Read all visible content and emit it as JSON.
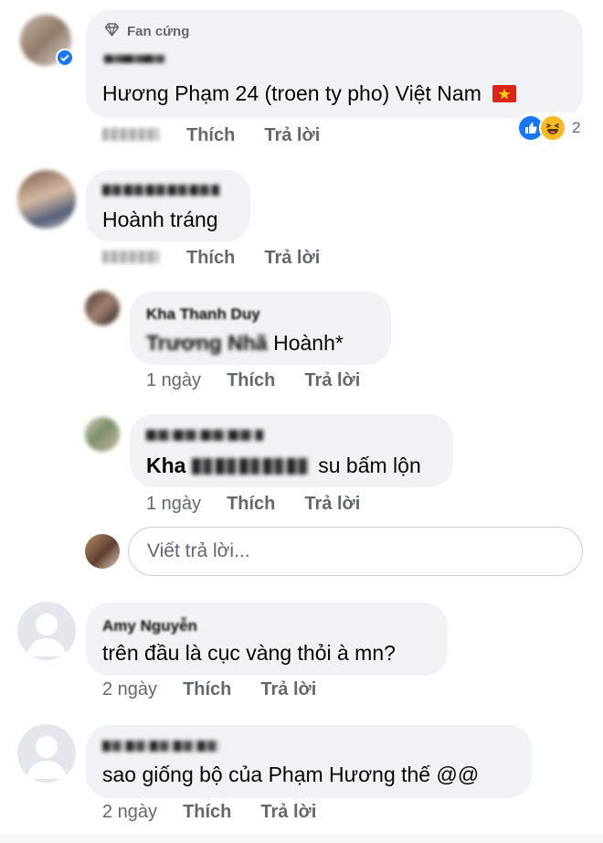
{
  "comments": [
    {
      "badge": "Fan cứng",
      "author": "",
      "text": "Hương Phạm 24 (troen ty pho) Việt Nam",
      "flag": "🇻🇳",
      "time": "",
      "like_label": "Thích",
      "reply_label": "Trả lời",
      "reaction_count": "2"
    },
    {
      "author": "",
      "text": "Hoành tráng",
      "time": "",
      "like_label": "Thích",
      "reply_label": "Trả lời"
    },
    {
      "author": "Kha Thanh Duy",
      "text_prefix": "Trương Nhã",
      "text": "Hoành*",
      "time": "1 ngày",
      "like_label": "Thích",
      "reply_label": "Trả lời"
    },
    {
      "author": "",
      "text_prefix": "Kha",
      "text": "su bấm lộn",
      "time": "1 ngày",
      "like_label": "Thích",
      "reply_label": "Trả lời"
    },
    {
      "author": "Amy Nguyễn",
      "text": "trên đầu là cục vàng thỏi à mn?",
      "time": "2 ngày",
      "like_label": "Thích",
      "reply_label": "Trả lời"
    },
    {
      "author": "",
      "text": "sao giống bộ của Phạm Hương thế @@",
      "time": "2 ngày",
      "like_label": "Thích",
      "reply_label": "Trả lời"
    }
  ],
  "reply_box": {
    "placeholder": "Viết trả lời..."
  },
  "icons": {
    "verified": "verified-badge-icon",
    "fan_badge": "diamond-icon",
    "like": "like-reaction-icon",
    "haha": "haha-reaction-icon"
  },
  "colors": {
    "bubble": "#f0f2f5",
    "meta_text": "#65676b",
    "like_blue": "#1877f2",
    "haha_yellow": "#f7b928"
  }
}
